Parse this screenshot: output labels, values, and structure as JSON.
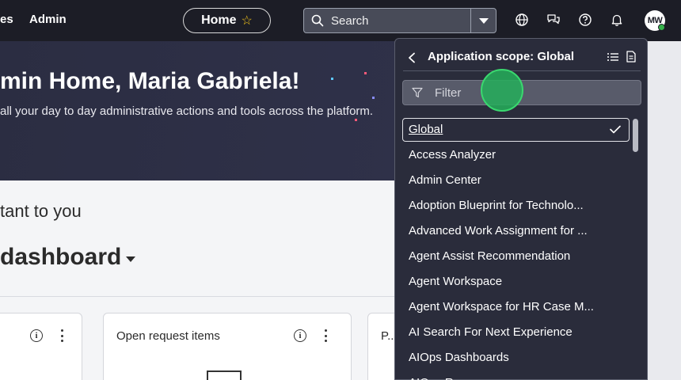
{
  "nav": {
    "partial_left_link": "es",
    "admin_link": "Admin",
    "home_label": "Home",
    "search_placeholder": "Search",
    "avatar_initials": "MW",
    "colors": {
      "bar": "#1c1d26",
      "status_online": "#35b34a",
      "favorite_star": "#f5c518"
    }
  },
  "hero": {
    "title": "min Home, Maria Gabriela!",
    "subtitle": "all your day to day administrative actions and tools across the platform."
  },
  "main": {
    "section_title": "tant to you",
    "dashboard_title": "dashboard",
    "cards": [
      {
        "title": ""
      },
      {
        "title": "Open request items"
      },
      {
        "title": "P..."
      }
    ]
  },
  "scope_panel": {
    "title": "Application scope: Global",
    "filter_placeholder": "Filter",
    "items": [
      {
        "label": "Global",
        "selected": true
      },
      {
        "label": "Access Analyzer"
      },
      {
        "label": "Admin Center"
      },
      {
        "label": "Adoption Blueprint for Technolo..."
      },
      {
        "label": "Advanced Work Assignment for ..."
      },
      {
        "label": "Agent Assist Recommendation"
      },
      {
        "label": "Agent Workspace"
      },
      {
        "label": "Agent Workspace for HR Case M..."
      },
      {
        "label": "AI Search For Next Experience"
      },
      {
        "label": "AIOps Dashboards"
      },
      {
        "label": "AIOps Ru..."
      }
    ],
    "colors": {
      "panel_bg": "#2a2c3b",
      "filter_bg": "#585b6a",
      "click_marker": "#24af5a"
    }
  }
}
